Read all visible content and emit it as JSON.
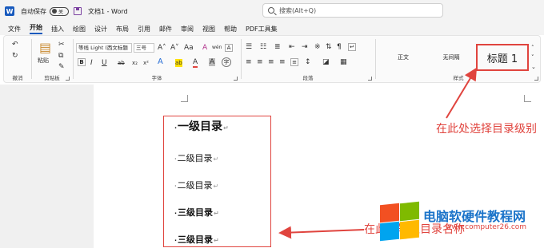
{
  "titlebar": {
    "app_logo": "W",
    "autosave_label": "自动保存",
    "autosave_state": "关",
    "doc_title": "文档1 - Word",
    "search_placeholder": "搜索(Alt+Q)"
  },
  "menu": {
    "items": [
      "文件",
      "开始",
      "插入",
      "绘图",
      "设计",
      "布局",
      "引用",
      "邮件",
      "审阅",
      "视图",
      "帮助",
      "PDF工具集"
    ],
    "active": "开始"
  },
  "ribbon": {
    "undo_group_label": "撤消",
    "clipboard_label": "剪贴板",
    "paste_label": "粘贴",
    "font_group_label": "字体",
    "font_name": "等线 Light (西文标题",
    "font_size": "三号",
    "grow_font": "A˄",
    "shrink_font": "A˅",
    "case_button": "Aa",
    "clear_format": "A",
    "phonetic_guide": "wén",
    "char_border": "A",
    "bold": "B",
    "italic": "I",
    "underline": "U",
    "strike": "ab",
    "subscript": "x₂",
    "superscript": "x²",
    "text_effects": "A",
    "highlight": "ab",
    "font_color": "A",
    "char_shading": "A",
    "enclose_char": "字",
    "paragraph_group_label": "段落",
    "styles_group_label": "样式",
    "styles": [
      "正文",
      "无间隔",
      "标题 1"
    ]
  },
  "document": {
    "toc_lines": [
      {
        "text": "一级目录",
        "level": 1
      },
      {
        "text": "二级目录",
        "level": 2
      },
      {
        "text": "二级目录",
        "level": 2
      },
      {
        "text": "三级目录",
        "level": 3
      },
      {
        "text": "三级目录",
        "level": 3
      }
    ],
    "paragraph_mark": "↵",
    "bullet": "·"
  },
  "annotations": {
    "select_level": "在此处选择目录级别",
    "enter_title": "在此处输入目录名称"
  },
  "watermark": {
    "site_name": "电脑软硬件教程网",
    "url": "www.computer26.com"
  },
  "colors": {
    "accent": "#185abd",
    "annotation_red": "#e0443e"
  }
}
